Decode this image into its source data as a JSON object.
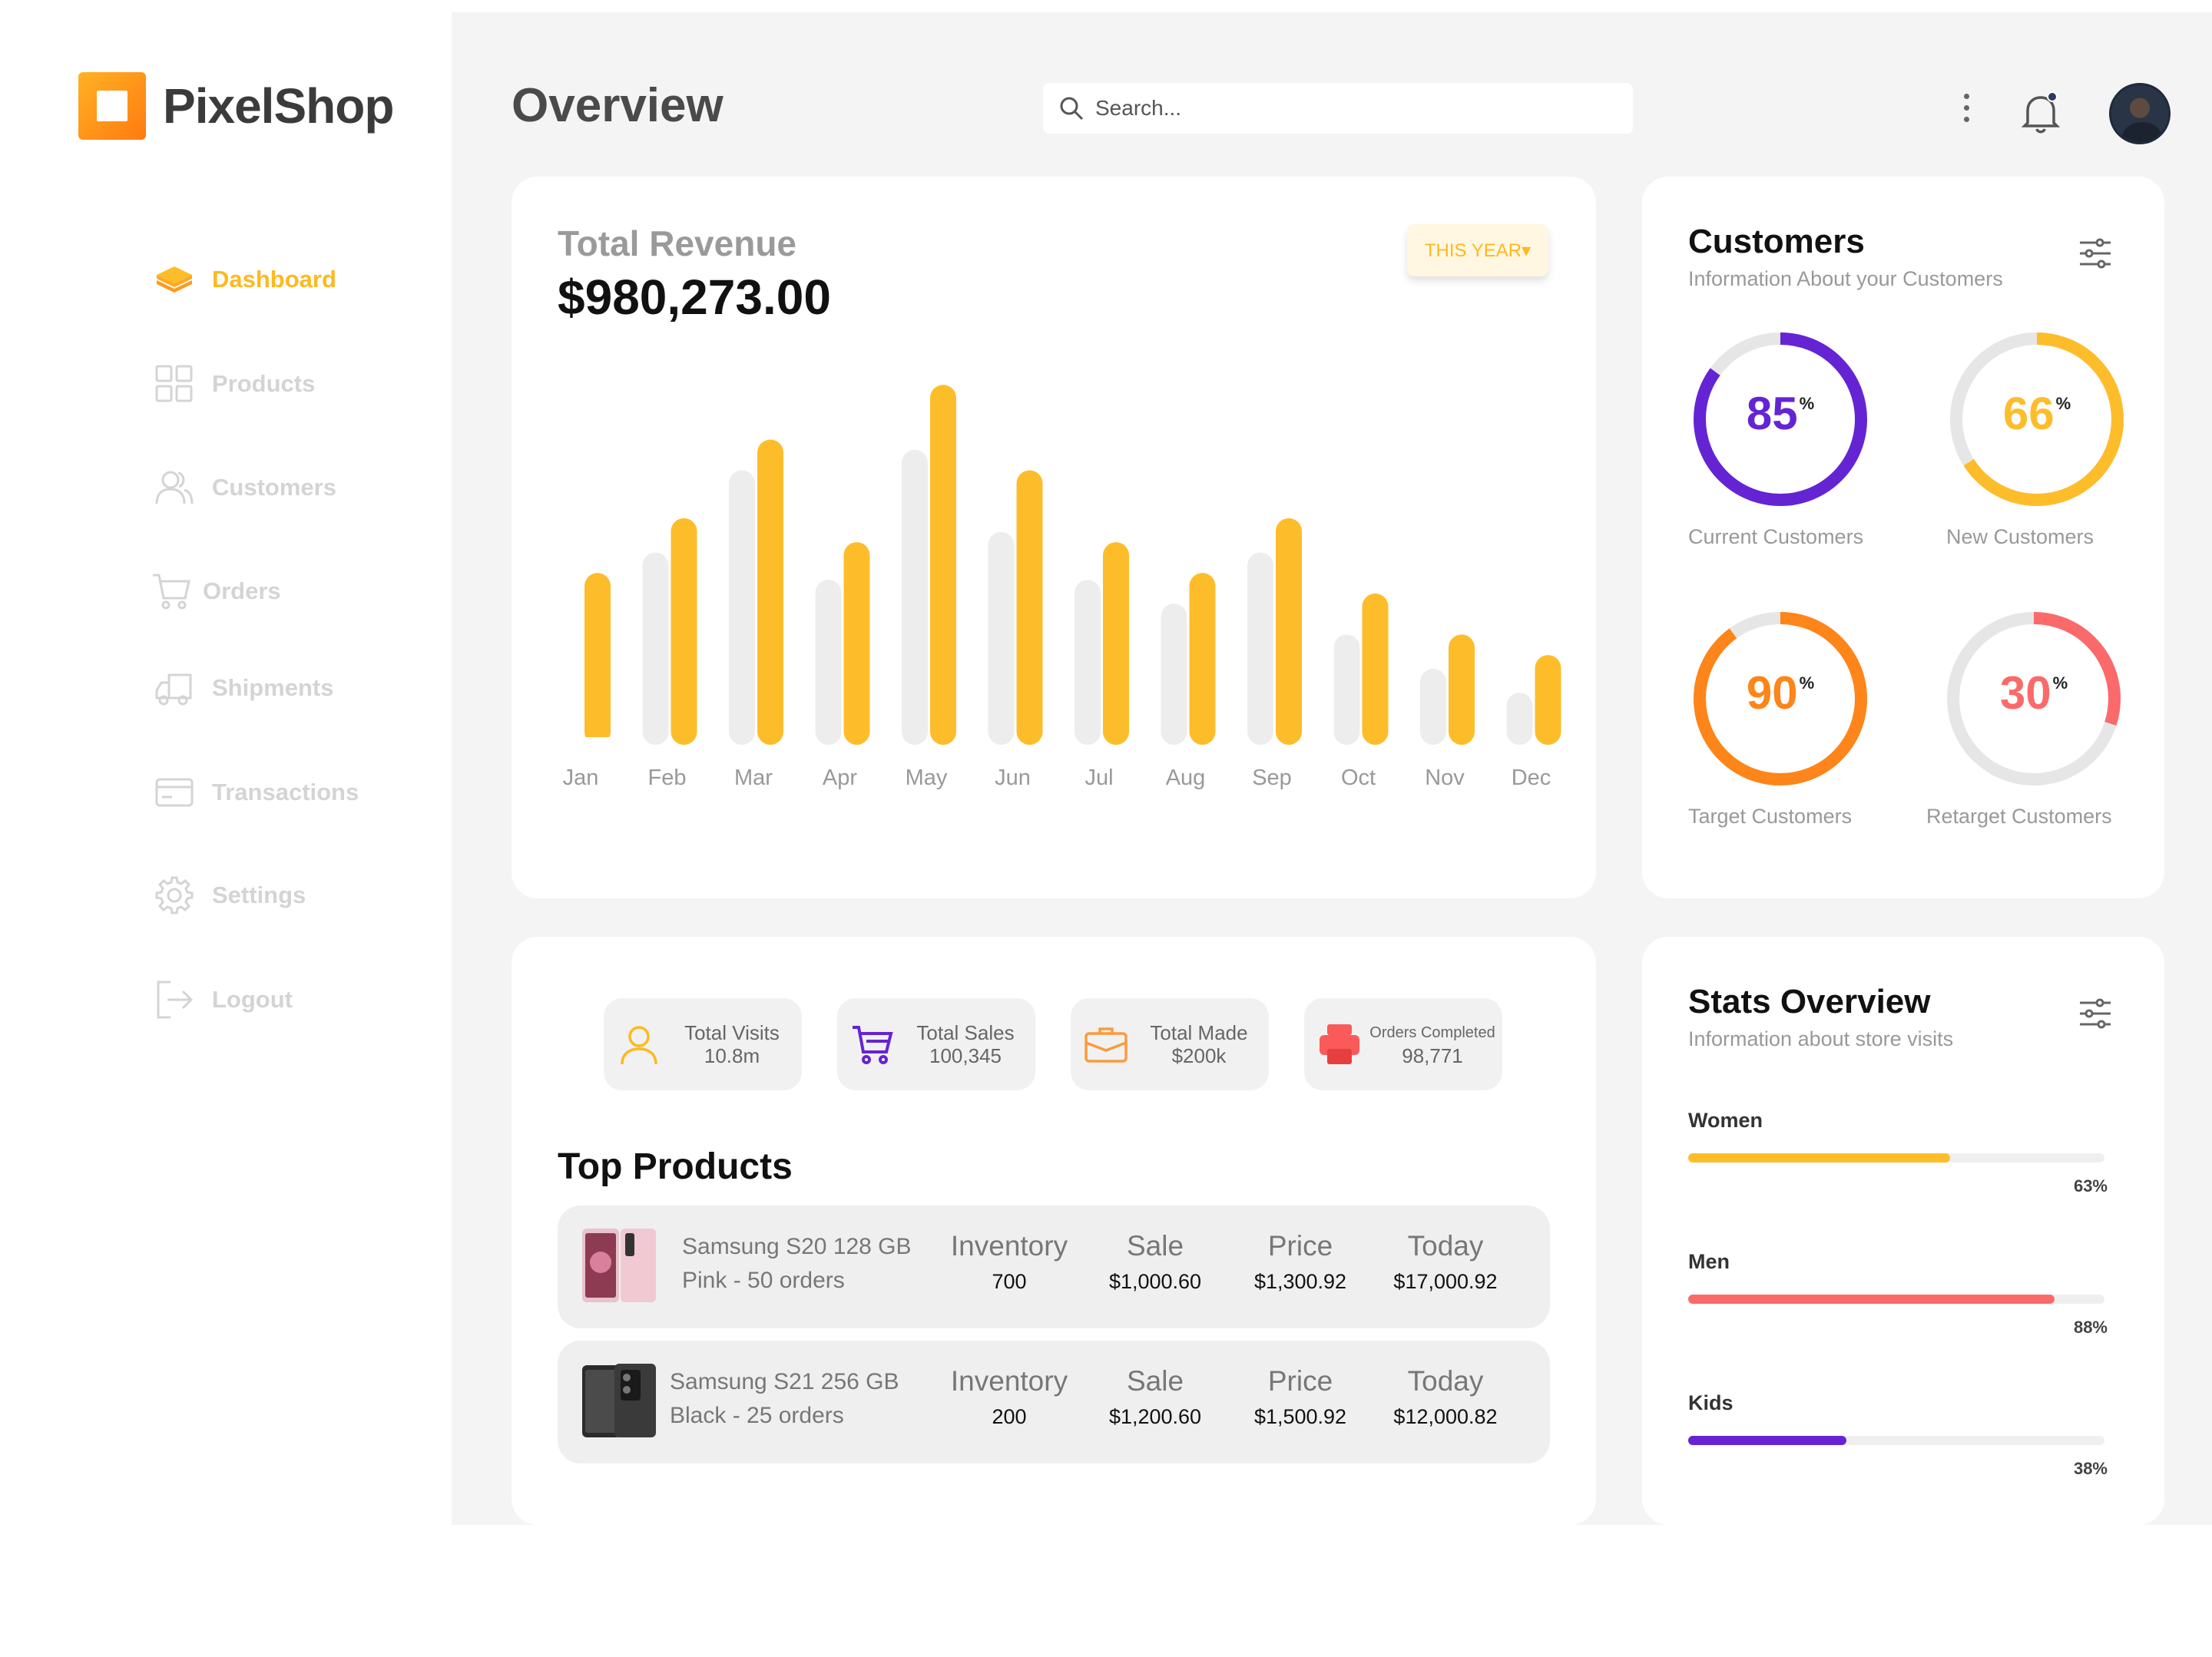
{
  "app": {
    "name": "PixelShop"
  },
  "nav": {
    "items": [
      {
        "label": "Dashboard",
        "icon": "layers-icon",
        "active": true
      },
      {
        "label": "Products",
        "icon": "grid-icon",
        "active": false
      },
      {
        "label": "Customers",
        "icon": "users-icon",
        "active": false
      },
      {
        "label": "Orders",
        "icon": "cart-icon",
        "active": false
      },
      {
        "label": "Shipments",
        "icon": "truck-icon",
        "active": false
      },
      {
        "label": "Transactions",
        "icon": "card-icon",
        "active": false
      },
      {
        "label": "Settings",
        "icon": "gear-icon",
        "active": false
      },
      {
        "label": "Logout",
        "icon": "logout-icon",
        "active": false
      }
    ]
  },
  "header": {
    "title": "Overview",
    "search_placeholder": "Search..."
  },
  "revenue": {
    "label": "Total Revenue",
    "value": "$980,273.00",
    "period_button": "THIS YEAR▾"
  },
  "chart_data": {
    "type": "bar",
    "categories": [
      "Jan",
      "Feb",
      "Mar",
      "Apr",
      "May",
      "Jun",
      "Jul",
      "Aug",
      "Sep",
      "Oct",
      "Nov",
      "Dec"
    ],
    "series": [
      {
        "values": [
          null,
          54,
          78,
          46,
          84,
          60,
          46,
          39,
          54,
          30,
          20,
          13
        ],
        "color": "#ededed"
      },
      {
        "values": [
          48,
          64,
          87,
          57,
          103,
          78,
          57,
          48,
          64,
          42,
          30,
          24
        ],
        "color": "#fdbd2b"
      }
    ],
    "ylim": [
      0,
      110
    ],
    "grid": false,
    "legend": "none"
  },
  "customers": {
    "title": "Customers",
    "subtitle": "Information About your Customers",
    "metrics": [
      {
        "label": "Current Customers",
        "value": "85",
        "percent": 85,
        "color": "#6524d4"
      },
      {
        "label": "New Customers",
        "value": "66",
        "percent": 66,
        "color": "#fdbd2b"
      },
      {
        "label": "Target Customers",
        "value": "90",
        "percent": 90,
        "color": "#fd8519"
      },
      {
        "label": "Retarget Customers",
        "value": "30",
        "percent": 30,
        "color": "#fb6a6a"
      }
    ],
    "percent_sign": "%"
  },
  "summary": [
    {
      "label": "Total Visits",
      "value": "10.8m",
      "icon": "user-icon",
      "color": "#fdb91f"
    },
    {
      "label": "Total Sales",
      "value": "100,345",
      "icon": "cart-icon",
      "color": "#6524d4"
    },
    {
      "label": "Total Made",
      "value": "$200k",
      "icon": "briefcase-icon",
      "color": "#fd9a3c"
    },
    {
      "label": "Orders Completed",
      "value": "98,771",
      "icon": "printer-icon",
      "color": "#fb5a5a"
    }
  ],
  "top_products": {
    "title": "Top Products",
    "columns": [
      "Inventory",
      "Sale",
      "Price",
      "Today"
    ],
    "rows": [
      {
        "name": "Samsung S20 128 GB",
        "detail": "Pink - 50 orders",
        "inventory": "700",
        "sale": "$1,000.60",
        "price": "$1,300.92",
        "today": "$17,000.92"
      },
      {
        "name": "Samsung S21 256 GB",
        "detail": "Black - 25 orders",
        "inventory": "200",
        "sale": "$1,200.60",
        "price": "$1,500.92",
        "today": "$12,000.82"
      }
    ]
  },
  "stats": {
    "title": "Stats Overview",
    "subtitle": "Information about store visits",
    "bars": [
      {
        "label": "Women",
        "percent": 63,
        "value": "63%",
        "color": "#fdbd2b"
      },
      {
        "label": "Men",
        "percent": 88,
        "value": "88%",
        "color": "#fb6a6a"
      },
      {
        "label": "Kids",
        "percent": 38,
        "value": "38%",
        "color": "#6524d4"
      }
    ]
  }
}
